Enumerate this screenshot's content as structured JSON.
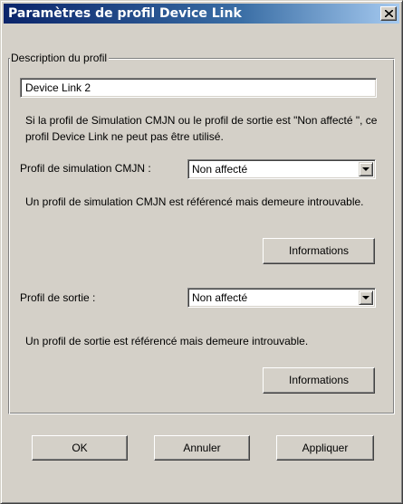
{
  "window": {
    "title": "Paramètres de profil Device Link",
    "close_label": "Fermer"
  },
  "group": {
    "legend": "Description du profil",
    "description_value": "Device Link 2",
    "info_text": "Si la profil de Simulation CMJN ou le profil de sortie est \"Non affecté \", ce profil Device Link ne peut pas être utilisé."
  },
  "simulation": {
    "label": "Profil de simulation CMJN :",
    "selected": "Non affecté",
    "message": "Un profil de simulation CMJN est référencé mais demeure introuvable.",
    "info_button": "Informations"
  },
  "output": {
    "label": "Profil de sortie :",
    "selected": "Non affecté",
    "message": "Un profil de sortie est référencé mais demeure introuvable.",
    "info_button": "Informations"
  },
  "footer": {
    "ok": "OK",
    "cancel": "Annuler",
    "apply": "Appliquer"
  },
  "icons": {
    "close": "close-icon",
    "dropdown": "chevron-down-icon"
  }
}
